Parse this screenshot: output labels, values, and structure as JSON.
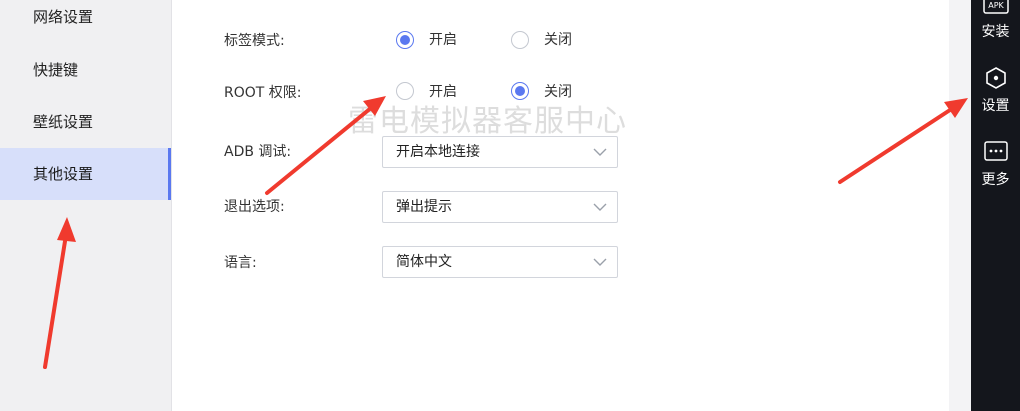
{
  "sidebar": {
    "items": [
      {
        "label": "网络设置"
      },
      {
        "label": "快捷键"
      },
      {
        "label": "壁纸设置"
      },
      {
        "label": "其他设置"
      }
    ]
  },
  "settings": {
    "tab_mode": {
      "label": "标签模式:",
      "on": "开启",
      "off": "关闭",
      "selected": "开启"
    },
    "root": {
      "label": "ROOT 权限:",
      "on": "开启",
      "off": "关闭",
      "selected": "关闭"
    },
    "adb": {
      "label": "ADB 调试:",
      "value": "开启本地连接"
    },
    "exit": {
      "label": "退出选项:",
      "value": "弹出提示"
    },
    "language": {
      "label": "语言:",
      "value": "简体中文"
    }
  },
  "right_bar": {
    "install": {
      "icon_text": "APK",
      "label": "安装"
    },
    "settings": {
      "label": "设置"
    },
    "more": {
      "label": "更多"
    }
  },
  "watermark": "雷电模拟器客服中心",
  "colors": {
    "accent": "#5a78f0",
    "arrow": "#f03a2e",
    "right_bar": "#14161c"
  }
}
